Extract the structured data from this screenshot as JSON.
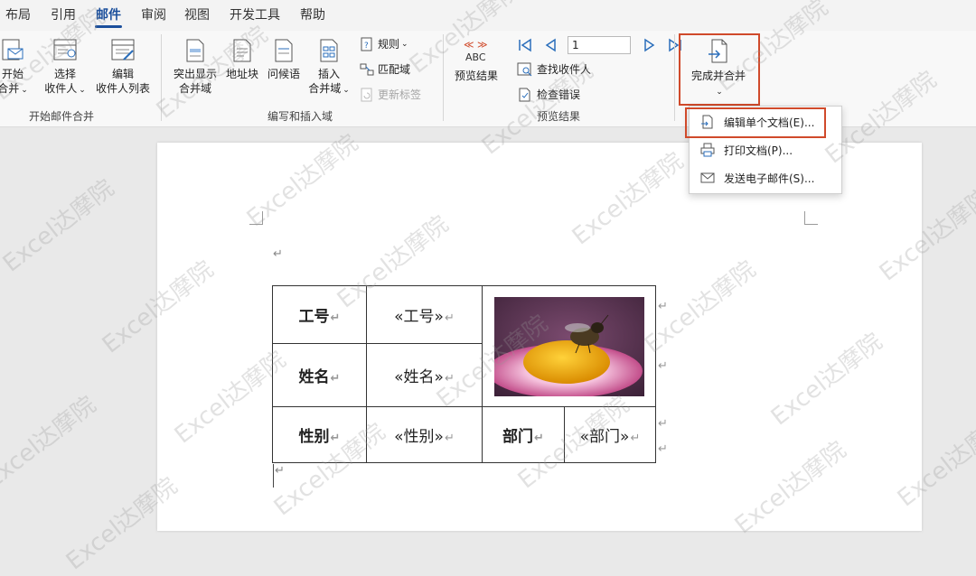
{
  "tabs": [
    "布局",
    "引用",
    "邮件",
    "审阅",
    "视图",
    "开发工具",
    "帮助"
  ],
  "active_tab": "邮件",
  "ribbon": {
    "start_group": {
      "start_btn_line1": "开始",
      "start_btn_line2": "合并",
      "select_btn_line1": "选择",
      "select_btn_line2": "收件人",
      "edit_btn_line1": "编辑",
      "edit_btn_line2": "收件人列表",
      "label": "开始邮件合并"
    },
    "write_group": {
      "highlight_line1": "突出显示",
      "highlight_line2": "合并域",
      "address_block": "地址块",
      "greeting": "问候语",
      "insert_line1": "插入",
      "insert_line2": "合并域",
      "rules": "规则",
      "match_fields": "匹配域",
      "update_labels": "更新标签",
      "label": "编写和插入域"
    },
    "preview_group": {
      "abc_icon_text": "ABC",
      "preview_results": "预览结果",
      "record_value": "1",
      "find_recipient": "查找收件人",
      "check_errors": "检查错误",
      "label": "预览结果"
    },
    "finish_group": {
      "finish_label": "完成并合并"
    }
  },
  "dropdown": {
    "items": [
      "编辑单个文档(E)...",
      "打印文档(P)...",
      "发送电子邮件(S)..."
    ]
  },
  "document": {
    "table": {
      "row1": {
        "label": "工号",
        "field": "«工号»"
      },
      "row2": {
        "label": "姓名",
        "field": "«姓名»"
      },
      "row3": {
        "label": "性别",
        "field": "«性别»",
        "label2": "部门",
        "field2": "«部门»"
      }
    },
    "para_mark": "↵"
  },
  "watermark_text": "Excel达摩院",
  "colors": {
    "accent": "#1b4f9c",
    "highlight": "#d04a2b"
  }
}
